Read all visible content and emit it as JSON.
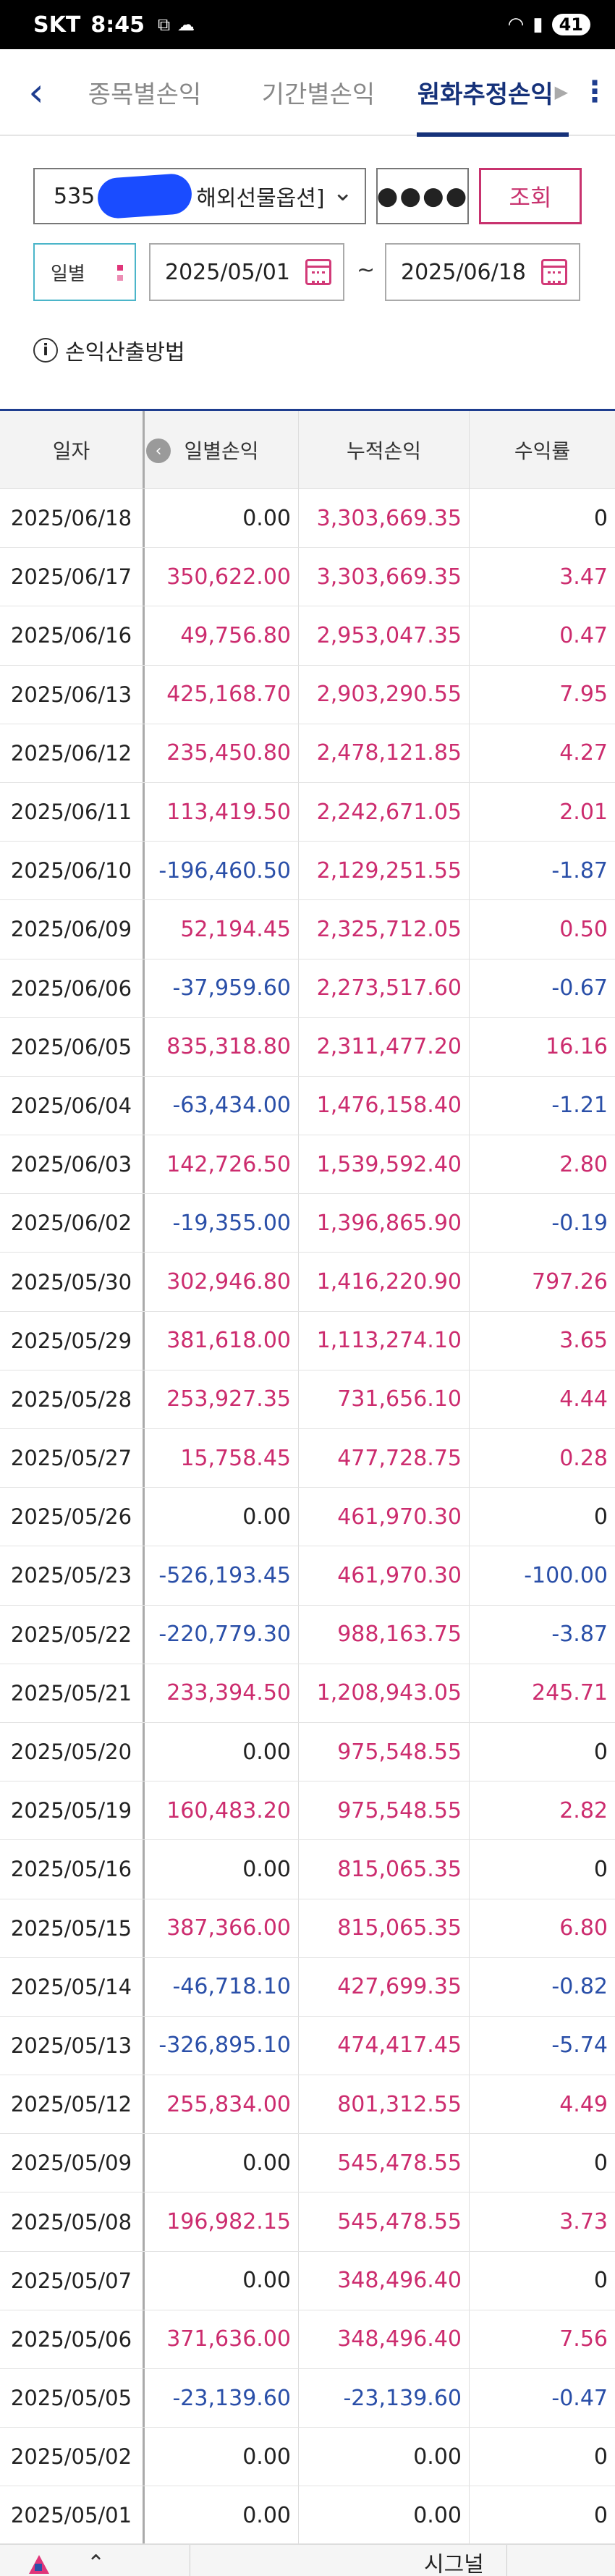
{
  "status": {
    "carrier": "SKT",
    "time": "8:45",
    "battery": "41"
  },
  "tabs": [
    {
      "label": "종목별손익"
    },
    {
      "label": "기간별손익"
    },
    {
      "label": "원화추정손익"
    }
  ],
  "filter": {
    "account_prefix": "535",
    "account_suffix": "해외선물옵션]",
    "password_mask": "●●●●",
    "query_label": "조회",
    "period_label": "일별",
    "date_from": "2025/05/01",
    "date_to": "2025/06/18",
    "range_separator": "~",
    "method_label": "손익산출방법"
  },
  "table": {
    "headers": [
      "일자",
      "일별손익",
      "누적손익",
      "수익률"
    ],
    "rows": [
      {
        "date": "2025/06/18",
        "daily": "0.00",
        "cumulative": "3,303,669.35",
        "rate": "0"
      },
      {
        "date": "2025/06/17",
        "daily": "350,622.00",
        "cumulative": "3,303,669.35",
        "rate": "3.47"
      },
      {
        "date": "2025/06/16",
        "daily": "49,756.80",
        "cumulative": "2,953,047.35",
        "rate": "0.47"
      },
      {
        "date": "2025/06/13",
        "daily": "425,168.70",
        "cumulative": "2,903,290.55",
        "rate": "7.95"
      },
      {
        "date": "2025/06/12",
        "daily": "235,450.80",
        "cumulative": "2,478,121.85",
        "rate": "4.27"
      },
      {
        "date": "2025/06/11",
        "daily": "113,419.50",
        "cumulative": "2,242,671.05",
        "rate": "2.01"
      },
      {
        "date": "2025/06/10",
        "daily": "-196,460.50",
        "cumulative": "2,129,251.55",
        "rate": "-1.87"
      },
      {
        "date": "2025/06/09",
        "daily": "52,194.45",
        "cumulative": "2,325,712.05",
        "rate": "0.50"
      },
      {
        "date": "2025/06/06",
        "daily": "-37,959.60",
        "cumulative": "2,273,517.60",
        "rate": "-0.67"
      },
      {
        "date": "2025/06/05",
        "daily": "835,318.80",
        "cumulative": "2,311,477.20",
        "rate": "16.16"
      },
      {
        "date": "2025/06/04",
        "daily": "-63,434.00",
        "cumulative": "1,476,158.40",
        "rate": "-1.21"
      },
      {
        "date": "2025/06/03",
        "daily": "142,726.50",
        "cumulative": "1,539,592.40",
        "rate": "2.80"
      },
      {
        "date": "2025/06/02",
        "daily": "-19,355.00",
        "cumulative": "1,396,865.90",
        "rate": "-0.19"
      },
      {
        "date": "2025/05/30",
        "daily": "302,946.80",
        "cumulative": "1,416,220.90",
        "rate": "797.26"
      },
      {
        "date": "2025/05/29",
        "daily": "381,618.00",
        "cumulative": "1,113,274.10",
        "rate": "3.65"
      },
      {
        "date": "2025/05/28",
        "daily": "253,927.35",
        "cumulative": "731,656.10",
        "rate": "4.44"
      },
      {
        "date": "2025/05/27",
        "daily": "15,758.45",
        "cumulative": "477,728.75",
        "rate": "0.28"
      },
      {
        "date": "2025/05/26",
        "daily": "0.00",
        "cumulative": "461,970.30",
        "rate": "0"
      },
      {
        "date": "2025/05/23",
        "daily": "-526,193.45",
        "cumulative": "461,970.30",
        "rate": "-100.00"
      },
      {
        "date": "2025/05/22",
        "daily": "-220,779.30",
        "cumulative": "988,163.75",
        "rate": "-3.87"
      },
      {
        "date": "2025/05/21",
        "daily": "233,394.50",
        "cumulative": "1,208,943.05",
        "rate": "245.71"
      },
      {
        "date": "2025/05/20",
        "daily": "0.00",
        "cumulative": "975,548.55",
        "rate": "0"
      },
      {
        "date": "2025/05/19",
        "daily": "160,483.20",
        "cumulative": "975,548.55",
        "rate": "2.82"
      },
      {
        "date": "2025/05/16",
        "daily": "0.00",
        "cumulative": "815,065.35",
        "rate": "0"
      },
      {
        "date": "2025/05/15",
        "daily": "387,366.00",
        "cumulative": "815,065.35",
        "rate": "6.80"
      },
      {
        "date": "2025/05/14",
        "daily": "-46,718.10",
        "cumulative": "427,699.35",
        "rate": "-0.82"
      },
      {
        "date": "2025/05/13",
        "daily": "-326,895.10",
        "cumulative": "474,417.45",
        "rate": "-5.74"
      },
      {
        "date": "2025/05/12",
        "daily": "255,834.00",
        "cumulative": "801,312.55",
        "rate": "4.49"
      },
      {
        "date": "2025/05/09",
        "daily": "0.00",
        "cumulative": "545,478.55",
        "rate": "0"
      },
      {
        "date": "2025/05/08",
        "daily": "196,982.15",
        "cumulative": "545,478.55",
        "rate": "3.73"
      },
      {
        "date": "2025/05/07",
        "daily": "0.00",
        "cumulative": "348,496.40",
        "rate": "0"
      },
      {
        "date": "2025/05/06",
        "daily": "371,636.00",
        "cumulative": "348,496.40",
        "rate": "7.56"
      },
      {
        "date": "2025/05/05",
        "daily": "-23,139.60",
        "cumulative": "-23,139.60",
        "rate": "-0.47"
      },
      {
        "date": "2025/05/02",
        "daily": "0.00",
        "cumulative": "0.00",
        "rate": "0"
      },
      {
        "date": "2025/05/01",
        "daily": "0.00",
        "cumulative": "0.00",
        "rate": "0"
      }
    ]
  },
  "bottom": {
    "label": "시그널"
  },
  "colors": {
    "positive": "#cc2c6e",
    "negative": "#2a4fa8",
    "accent": "#16327a",
    "query": "#c8326e"
  },
  "icons": [
    "back-icon",
    "more-icon",
    "chevron-down-icon",
    "calendar-icon",
    "info-icon",
    "scroll-left-icon",
    "app-logo-icon"
  ]
}
